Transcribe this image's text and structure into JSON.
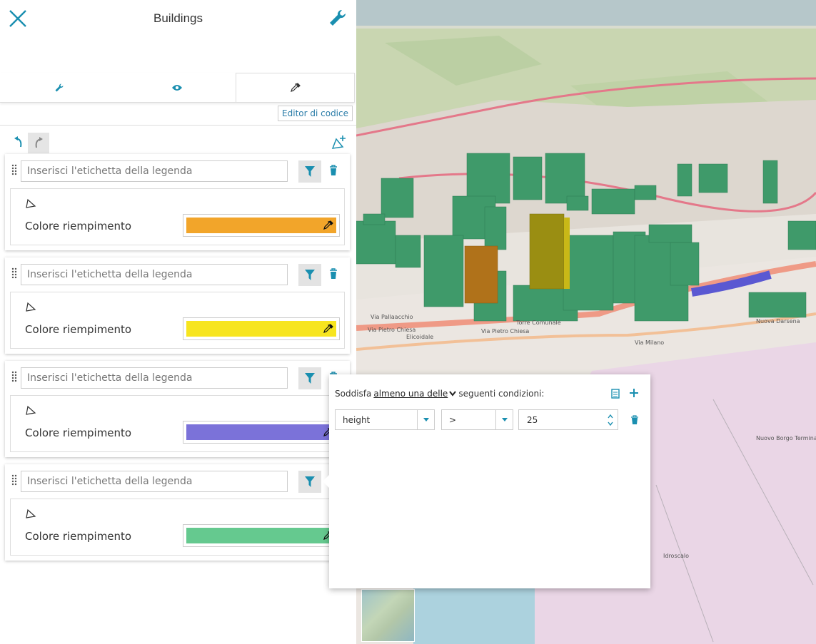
{
  "panel": {
    "title": "Buildings",
    "code_editor_label": "Editor di codice"
  },
  "tabs": [
    {
      "icon": "wrench-icon",
      "active": false
    },
    {
      "icon": "eye-icon",
      "active": false
    },
    {
      "icon": "eyedropper-icon",
      "active": true
    }
  ],
  "rules": [
    {
      "placeholder": "Inserisci l'etichetta della legenda",
      "fill_label": "Colore riempimento",
      "color": "#f2a52a"
    },
    {
      "placeholder": "Inserisci l'etichetta della legenda",
      "fill_label": "Colore riempimento",
      "color": "#f7e51f"
    },
    {
      "placeholder": "Inserisci l'etichetta della legenda",
      "fill_label": "Colore riempimento",
      "color": "#7b72d9"
    },
    {
      "placeholder": "Inserisci l'etichetta della legenda",
      "fill_label": "Colore riempimento",
      "color": "#65c98f"
    }
  ],
  "filter": {
    "prefix": "Soddisfa",
    "mode": "almeno una delle",
    "suffix": "seguenti condizioni:",
    "condition": {
      "attribute": "height",
      "operator": ">",
      "value": "25"
    }
  },
  "map": {
    "labels": [
      "Via Pietro Chiesa",
      "Via Pietro Chiesa",
      "Elicoidale",
      "Via Pallaacchio",
      "Torre Comunale",
      "Via Milano",
      "Nuovo Borgo Terminal Porto",
      "Idroscalo",
      "Nuova Darsena"
    ]
  },
  "colors": {
    "accent": "#1a8fb0",
    "building": "#3f9a6a"
  }
}
